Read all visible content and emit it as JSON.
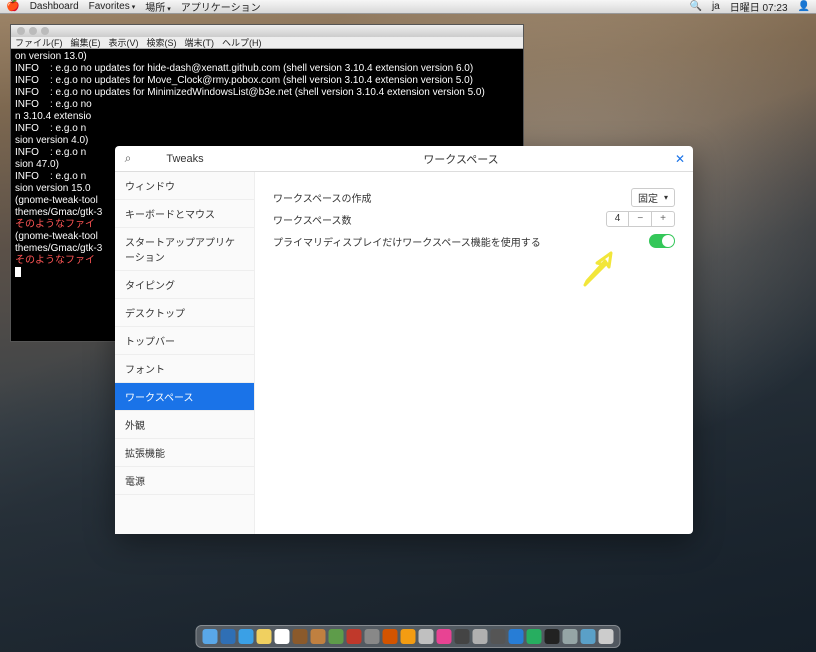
{
  "topbar": {
    "menus": [
      "Dashboard",
      "Favorites",
      "場所",
      "アプリケーション"
    ],
    "right": {
      "lang": "ja",
      "datetime": "日曜日 07:23"
    }
  },
  "terminal": {
    "title": "",
    "menubar": [
      "ファイル(F)",
      "編集(E)",
      "表示(V)",
      "検索(S)",
      "端末(T)",
      "ヘルプ(H)"
    ],
    "lines": [
      "on version 13.0)",
      "INFO    : e.g.o no updates for hide-dash@xenatt.github.com (shell version 3.10.4 extension version 6.0)",
      "INFO    : e.g.o no updates for Move_Clock@rmy.pobox.com (shell version 3.10.4 extension version 5.0)",
      "INFO    : e.g.o no updates for MinimizedWindowsList@b3e.net (shell version 3.10.4 extension version 5.0)",
      "INFO    : e.g.o no",
      "n 3.10.4 extensio",
      "INFO    : e.g.o n",
      "sion version 4.0)",
      "INFO    : e.g.o n",
      "sion 47.0)",
      "INFO    : e.g.o n",
      "sion version 15.0",
      "",
      "(gnome-tweak-tool",
      "themes/Gmac/gtk-3",
      "そのようなファイ",
      "",
      "(gnome-tweak-tool",
      "themes/Gmac/gtk-3",
      "そのようなファイ"
    ]
  },
  "tweaks": {
    "app_title": "Tweaks",
    "panel_title": "ワークスペース",
    "sidebar": [
      "ウィンドウ",
      "キーボードとマウス",
      "スタートアップアプリケーション",
      "タイピング",
      "デスクトップ",
      "トップバー",
      "フォント",
      "ワークスペース",
      "外観",
      "拡張機能",
      "電源"
    ],
    "selected_index": 7,
    "settings": {
      "creation_label": "ワークスペースの作成",
      "creation_value": "固定",
      "count_label": "ワークスペース数",
      "count_value": "4",
      "primary_label": "プライマリディスプレイだけワークスペース機能を使用する",
      "primary_on": true
    }
  },
  "dock": {
    "items": [
      {
        "name": "finder",
        "color": "#59a7e8"
      },
      {
        "name": "store",
        "color": "#2f6fb5"
      },
      {
        "name": "safari",
        "color": "#3aa0e6"
      },
      {
        "name": "notes",
        "color": "#f0d060"
      },
      {
        "name": "calendar",
        "color": "#ffffff"
      },
      {
        "name": "calculator",
        "color": "#8b5a2b"
      },
      {
        "name": "chess",
        "color": "#c08040"
      },
      {
        "name": "preview",
        "color": "#5e9c4a"
      },
      {
        "name": "brasero",
        "color": "#c0392b"
      },
      {
        "name": "tool",
        "color": "#888888"
      },
      {
        "name": "transmission",
        "color": "#d35400"
      },
      {
        "name": "chat",
        "color": "#f39c12"
      },
      {
        "name": "rhythmbox",
        "color": "#c0c0c0"
      },
      {
        "name": "itunes",
        "color": "#e84393"
      },
      {
        "name": "video",
        "color": "#444"
      },
      {
        "name": "dictionary",
        "color": "#b0b0b0"
      },
      {
        "name": "recorder",
        "color": "#555"
      },
      {
        "name": "activity",
        "color": "#277dd6"
      },
      {
        "name": "time",
        "color": "#27ae60"
      },
      {
        "name": "terminal",
        "color": "#222"
      },
      {
        "name": "settings",
        "color": "#95a5a6"
      },
      {
        "name": "display",
        "color": "#5aa0c8"
      },
      {
        "name": "trash",
        "color": "#cccccc"
      }
    ]
  }
}
